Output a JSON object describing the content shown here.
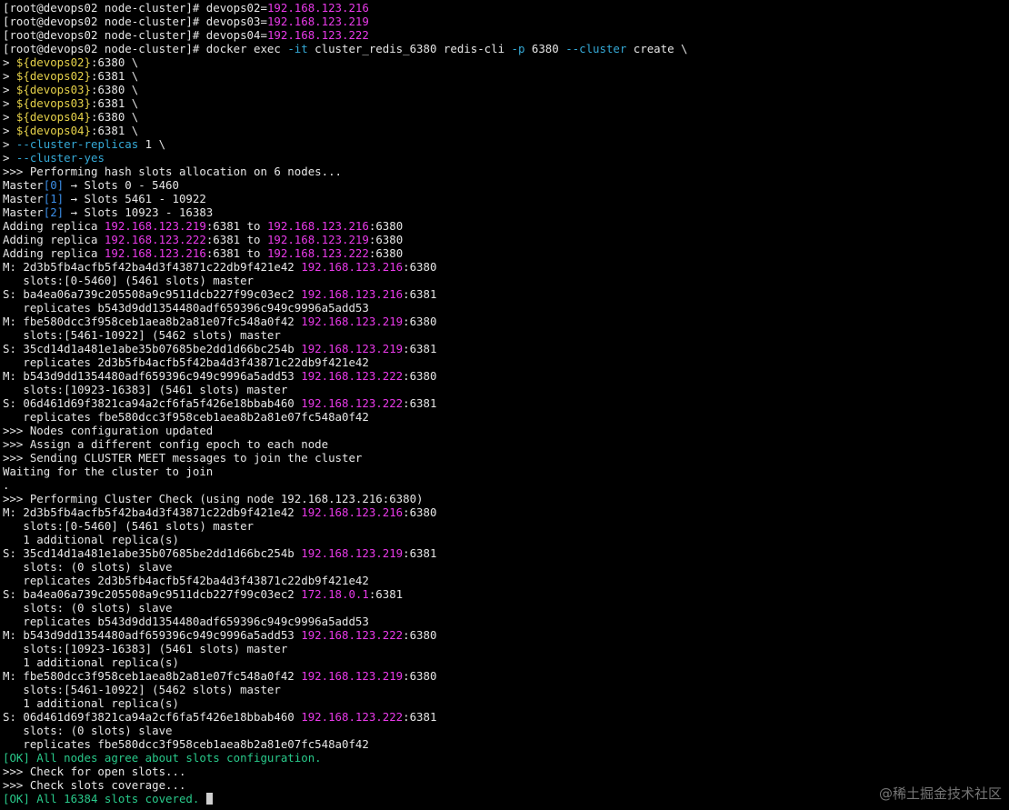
{
  "terminal": {
    "lines": [
      {
        "segs": [
          [
            "n",
            "[root@devops02 node-cluster]# devops02="
          ],
          [
            "ip",
            "192.168.123.216"
          ]
        ]
      },
      {
        "segs": [
          [
            "n",
            "[root@devops02 node-cluster]# devops03="
          ],
          [
            "ip",
            "192.168.123.219"
          ]
        ]
      },
      {
        "segs": [
          [
            "n",
            "[root@devops02 node-cluster]# devops04="
          ],
          [
            "ip",
            "192.168.123.222"
          ]
        ]
      },
      {
        "segs": [
          [
            "n",
            "[root@devops02 node-cluster]# docker exec "
          ],
          [
            "opt",
            "-it"
          ],
          [
            "n",
            " cluster_redis_6380 redis-cli "
          ],
          [
            "opt",
            "-p"
          ],
          [
            "n",
            " 6380 "
          ],
          [
            "opt",
            "--cluster"
          ],
          [
            "n",
            " create \\"
          ]
        ]
      },
      {
        "segs": [
          [
            "n",
            "> "
          ],
          [
            "var",
            "${devops02}"
          ],
          [
            "n",
            ":6380 \\"
          ]
        ]
      },
      {
        "segs": [
          [
            "n",
            "> "
          ],
          [
            "var",
            "${devops02}"
          ],
          [
            "n",
            ":6381 \\"
          ]
        ]
      },
      {
        "segs": [
          [
            "n",
            "> "
          ],
          [
            "var",
            "${devops03}"
          ],
          [
            "n",
            ":6380 \\"
          ]
        ]
      },
      {
        "segs": [
          [
            "n",
            "> "
          ],
          [
            "var",
            "${devops03}"
          ],
          [
            "n",
            ":6381 \\"
          ]
        ]
      },
      {
        "segs": [
          [
            "n",
            "> "
          ],
          [
            "var",
            "${devops04}"
          ],
          [
            "n",
            ":6380 \\"
          ]
        ]
      },
      {
        "segs": [
          [
            "n",
            "> "
          ],
          [
            "var",
            "${devops04}"
          ],
          [
            "n",
            ":6381 \\"
          ]
        ]
      },
      {
        "segs": [
          [
            "n",
            "> "
          ],
          [
            "opt",
            "--cluster-replicas"
          ],
          [
            "n",
            " 1 \\"
          ]
        ]
      },
      {
        "segs": [
          [
            "n",
            "> "
          ],
          [
            "opt",
            "--cluster-yes"
          ]
        ]
      },
      {
        "segs": [
          [
            "n",
            ">>> Performing hash slots allocation on 6 nodes..."
          ]
        ]
      },
      {
        "segs": [
          [
            "n",
            "Master"
          ],
          [
            "idx",
            "[0]"
          ],
          [
            "n",
            " → Slots 0 - 5460"
          ]
        ]
      },
      {
        "segs": [
          [
            "n",
            "Master"
          ],
          [
            "idx",
            "[1]"
          ],
          [
            "n",
            " → Slots 5461 - 10922"
          ]
        ]
      },
      {
        "segs": [
          [
            "n",
            "Master"
          ],
          [
            "idx",
            "[2]"
          ],
          [
            "n",
            " → Slots 10923 - 16383"
          ]
        ]
      },
      {
        "segs": [
          [
            "n",
            "Adding replica "
          ],
          [
            "ip",
            "192.168.123.219"
          ],
          [
            "n",
            ":6381 to "
          ],
          [
            "ip",
            "192.168.123.216"
          ],
          [
            "n",
            ":6380"
          ]
        ]
      },
      {
        "segs": [
          [
            "n",
            "Adding replica "
          ],
          [
            "ip",
            "192.168.123.222"
          ],
          [
            "n",
            ":6381 to "
          ],
          [
            "ip",
            "192.168.123.219"
          ],
          [
            "n",
            ":6380"
          ]
        ]
      },
      {
        "segs": [
          [
            "n",
            "Adding replica "
          ],
          [
            "ip",
            "192.168.123.216"
          ],
          [
            "n",
            ":6381 to "
          ],
          [
            "ip",
            "192.168.123.222"
          ],
          [
            "n",
            ":6380"
          ]
        ]
      },
      {
        "segs": [
          [
            "n",
            "M: 2d3b5fb4acfb5f42ba4d3f43871c22db9f421e42 "
          ],
          [
            "ip",
            "192.168.123.216"
          ],
          [
            "n",
            ":6380"
          ]
        ]
      },
      {
        "segs": [
          [
            "n",
            "   slots:[0-5460] (5461 slots) master"
          ]
        ]
      },
      {
        "segs": [
          [
            "n",
            "S: ba4ea06a739c205508a9c9511dcb227f99c03ec2 "
          ],
          [
            "ip",
            "192.168.123.216"
          ],
          [
            "n",
            ":6381"
          ]
        ]
      },
      {
        "segs": [
          [
            "n",
            "   replicates b543d9dd1354480adf659396c949c9996a5add53"
          ]
        ]
      },
      {
        "segs": [
          [
            "n",
            "M: fbe580dcc3f958ceb1aea8b2a81e07fc548a0f42 "
          ],
          [
            "ip",
            "192.168.123.219"
          ],
          [
            "n",
            ":6380"
          ]
        ]
      },
      {
        "segs": [
          [
            "n",
            "   slots:[5461-10922] (5462 slots) master"
          ]
        ]
      },
      {
        "segs": [
          [
            "n",
            "S: 35cd14d1a481e1abe35b07685be2dd1d66bc254b "
          ],
          [
            "ip",
            "192.168.123.219"
          ],
          [
            "n",
            ":6381"
          ]
        ]
      },
      {
        "segs": [
          [
            "n",
            "   replicates 2d3b5fb4acfb5f42ba4d3f43871c22db9f421e42"
          ]
        ]
      },
      {
        "segs": [
          [
            "n",
            "M: b543d9dd1354480adf659396c949c9996a5add53 "
          ],
          [
            "ip",
            "192.168.123.222"
          ],
          [
            "n",
            ":6380"
          ]
        ]
      },
      {
        "segs": [
          [
            "n",
            "   slots:[10923-16383] (5461 slots) master"
          ]
        ]
      },
      {
        "segs": [
          [
            "n",
            "S: 06d461d69f3821ca94a2cf6fa5f426e18bbab460 "
          ],
          [
            "ip",
            "192.168.123.222"
          ],
          [
            "n",
            ":6381"
          ]
        ]
      },
      {
        "segs": [
          [
            "n",
            "   replicates fbe580dcc3f958ceb1aea8b2a81e07fc548a0f42"
          ]
        ]
      },
      {
        "segs": [
          [
            "n",
            ">>> Nodes configuration updated"
          ]
        ]
      },
      {
        "segs": [
          [
            "n",
            ">>> Assign a different config epoch to each node"
          ]
        ]
      },
      {
        "segs": [
          [
            "n",
            ">>> Sending CLUSTER MEET messages to join the cluster"
          ]
        ]
      },
      {
        "segs": [
          [
            "n",
            "Waiting for the cluster to join"
          ]
        ]
      },
      {
        "segs": [
          [
            "n",
            "."
          ]
        ]
      },
      {
        "segs": [
          [
            "n",
            ">>> Performing Cluster Check (using node 192.168.123.216:6380)"
          ]
        ]
      },
      {
        "segs": [
          [
            "n",
            "M: 2d3b5fb4acfb5f42ba4d3f43871c22db9f421e42 "
          ],
          [
            "ip",
            "192.168.123.216"
          ],
          [
            "n",
            ":6380"
          ]
        ]
      },
      {
        "segs": [
          [
            "n",
            "   slots:[0-5460] (5461 slots) master"
          ]
        ]
      },
      {
        "segs": [
          [
            "n",
            "   1 additional replica(s)"
          ]
        ]
      },
      {
        "segs": [
          [
            "n",
            "S: 35cd14d1a481e1abe35b07685be2dd1d66bc254b "
          ],
          [
            "ip",
            "192.168.123.219"
          ],
          [
            "n",
            ":6381"
          ]
        ]
      },
      {
        "segs": [
          [
            "n",
            "   slots: (0 slots) slave"
          ]
        ]
      },
      {
        "segs": [
          [
            "n",
            "   replicates 2d3b5fb4acfb5f42ba4d3f43871c22db9f421e42"
          ]
        ]
      },
      {
        "segs": [
          [
            "n",
            "S: ba4ea06a739c205508a9c9511dcb227f99c03ec2 "
          ],
          [
            "ip",
            "172.18.0.1"
          ],
          [
            "n",
            ":6381"
          ]
        ]
      },
      {
        "segs": [
          [
            "n",
            "   slots: (0 slots) slave"
          ]
        ]
      },
      {
        "segs": [
          [
            "n",
            "   replicates b543d9dd1354480adf659396c949c9996a5add53"
          ]
        ]
      },
      {
        "segs": [
          [
            "n",
            "M: b543d9dd1354480adf659396c949c9996a5add53 "
          ],
          [
            "ip",
            "192.168.123.222"
          ],
          [
            "n",
            ":6380"
          ]
        ]
      },
      {
        "segs": [
          [
            "n",
            "   slots:[10923-16383] (5461 slots) master"
          ]
        ]
      },
      {
        "segs": [
          [
            "n",
            "   1 additional replica(s)"
          ]
        ]
      },
      {
        "segs": [
          [
            "n",
            "M: fbe580dcc3f958ceb1aea8b2a81e07fc548a0f42 "
          ],
          [
            "ip",
            "192.168.123.219"
          ],
          [
            "n",
            ":6380"
          ]
        ]
      },
      {
        "segs": [
          [
            "n",
            "   slots:[5461-10922] (5462 slots) master"
          ]
        ]
      },
      {
        "segs": [
          [
            "n",
            "   1 additional replica(s)"
          ]
        ]
      },
      {
        "segs": [
          [
            "n",
            "S: 06d461d69f3821ca94a2cf6fa5f426e18bbab460 "
          ],
          [
            "ip",
            "192.168.123.222"
          ],
          [
            "n",
            ":6381"
          ]
        ]
      },
      {
        "segs": [
          [
            "n",
            "   slots: (0 slots) slave"
          ]
        ]
      },
      {
        "segs": [
          [
            "n",
            "   replicates fbe580dcc3f958ceb1aea8b2a81e07fc548a0f42"
          ]
        ]
      },
      {
        "segs": [
          [
            "ok",
            "[OK] All nodes agree about slots configuration."
          ]
        ]
      },
      {
        "segs": [
          [
            "n",
            ">>> Check for open slots..."
          ]
        ]
      },
      {
        "segs": [
          [
            "n",
            ">>> Check slots coverage..."
          ]
        ]
      },
      {
        "segs": [
          [
            "ok",
            "[OK] All 16384 slots covered."
          ]
        ],
        "cursor": true
      }
    ]
  },
  "watermark": "@稀土掘金技术社区",
  "colors": {
    "background": "#000000",
    "text": "#e6e6e6",
    "ip": "#e83ae8",
    "variable": "#e6d24a",
    "option": "#35a9d6",
    "index": "#3b8ee8",
    "ok": "#29c98a"
  }
}
